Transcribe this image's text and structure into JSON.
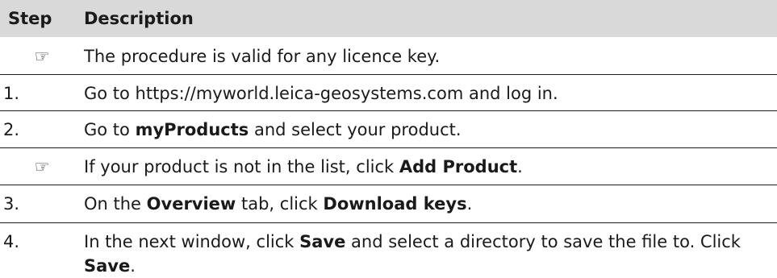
{
  "header": {
    "step": "Step",
    "description": "Description"
  },
  "rows": [
    {
      "step_icon": "pointing-hand-icon",
      "glyph": "☞",
      "parts": [
        "The procedure is valid for any licence key."
      ]
    },
    {
      "step": "1.",
      "parts": [
        "Go to https://myworld.leica-geosystems.com and log in."
      ]
    },
    {
      "step": "2.",
      "parts": [
        "Go to ",
        "myProducts",
        " and select your product."
      ]
    },
    {
      "step_icon": "pointing-hand-icon",
      "glyph": "☞",
      "parts": [
        "If your product is not in the list, click ",
        "Add Product",
        "."
      ]
    },
    {
      "step": "3.",
      "parts": [
        "On the ",
        "Overview",
        " tab, click ",
        "Download keys",
        "."
      ]
    },
    {
      "step": "4.",
      "parts": [
        "In the next window, click ",
        "Save",
        " and select a directory to save the file to. Click ",
        "Save",
        "."
      ]
    }
  ]
}
